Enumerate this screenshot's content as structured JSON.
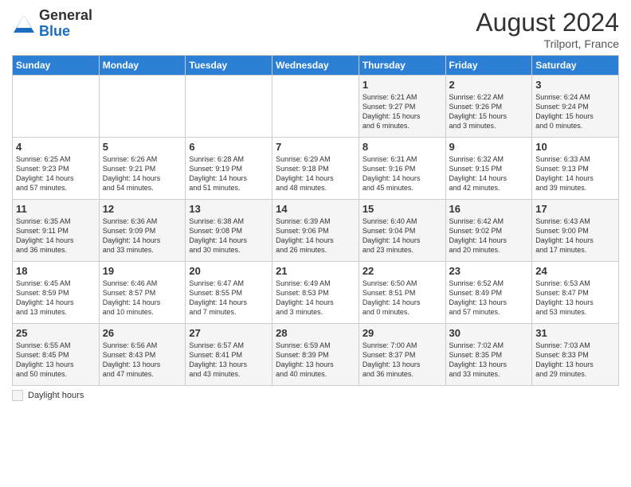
{
  "header": {
    "logo_general": "General",
    "logo_blue": "Blue",
    "month_year": "August 2024",
    "location": "Trilport, France"
  },
  "footer": {
    "legend_label": "Daylight hours"
  },
  "weekdays": [
    "Sunday",
    "Monday",
    "Tuesday",
    "Wednesday",
    "Thursday",
    "Friday",
    "Saturday"
  ],
  "weeks": [
    [
      {
        "day": "",
        "info": ""
      },
      {
        "day": "",
        "info": ""
      },
      {
        "day": "",
        "info": ""
      },
      {
        "day": "",
        "info": ""
      },
      {
        "day": "1",
        "info": "Sunrise: 6:21 AM\nSunset: 9:27 PM\nDaylight: 15 hours\nand 6 minutes."
      },
      {
        "day": "2",
        "info": "Sunrise: 6:22 AM\nSunset: 9:26 PM\nDaylight: 15 hours\nand 3 minutes."
      },
      {
        "day": "3",
        "info": "Sunrise: 6:24 AM\nSunset: 9:24 PM\nDaylight: 15 hours\nand 0 minutes."
      }
    ],
    [
      {
        "day": "4",
        "info": "Sunrise: 6:25 AM\nSunset: 9:23 PM\nDaylight: 14 hours\nand 57 minutes."
      },
      {
        "day": "5",
        "info": "Sunrise: 6:26 AM\nSunset: 9:21 PM\nDaylight: 14 hours\nand 54 minutes."
      },
      {
        "day": "6",
        "info": "Sunrise: 6:28 AM\nSunset: 9:19 PM\nDaylight: 14 hours\nand 51 minutes."
      },
      {
        "day": "7",
        "info": "Sunrise: 6:29 AM\nSunset: 9:18 PM\nDaylight: 14 hours\nand 48 minutes."
      },
      {
        "day": "8",
        "info": "Sunrise: 6:31 AM\nSunset: 9:16 PM\nDaylight: 14 hours\nand 45 minutes."
      },
      {
        "day": "9",
        "info": "Sunrise: 6:32 AM\nSunset: 9:15 PM\nDaylight: 14 hours\nand 42 minutes."
      },
      {
        "day": "10",
        "info": "Sunrise: 6:33 AM\nSunset: 9:13 PM\nDaylight: 14 hours\nand 39 minutes."
      }
    ],
    [
      {
        "day": "11",
        "info": "Sunrise: 6:35 AM\nSunset: 9:11 PM\nDaylight: 14 hours\nand 36 minutes."
      },
      {
        "day": "12",
        "info": "Sunrise: 6:36 AM\nSunset: 9:09 PM\nDaylight: 14 hours\nand 33 minutes."
      },
      {
        "day": "13",
        "info": "Sunrise: 6:38 AM\nSunset: 9:08 PM\nDaylight: 14 hours\nand 30 minutes."
      },
      {
        "day": "14",
        "info": "Sunrise: 6:39 AM\nSunset: 9:06 PM\nDaylight: 14 hours\nand 26 minutes."
      },
      {
        "day": "15",
        "info": "Sunrise: 6:40 AM\nSunset: 9:04 PM\nDaylight: 14 hours\nand 23 minutes."
      },
      {
        "day": "16",
        "info": "Sunrise: 6:42 AM\nSunset: 9:02 PM\nDaylight: 14 hours\nand 20 minutes."
      },
      {
        "day": "17",
        "info": "Sunrise: 6:43 AM\nSunset: 9:00 PM\nDaylight: 14 hours\nand 17 minutes."
      }
    ],
    [
      {
        "day": "18",
        "info": "Sunrise: 6:45 AM\nSunset: 8:59 PM\nDaylight: 14 hours\nand 13 minutes."
      },
      {
        "day": "19",
        "info": "Sunrise: 6:46 AM\nSunset: 8:57 PM\nDaylight: 14 hours\nand 10 minutes."
      },
      {
        "day": "20",
        "info": "Sunrise: 6:47 AM\nSunset: 8:55 PM\nDaylight: 14 hours\nand 7 minutes."
      },
      {
        "day": "21",
        "info": "Sunrise: 6:49 AM\nSunset: 8:53 PM\nDaylight: 14 hours\nand 3 minutes."
      },
      {
        "day": "22",
        "info": "Sunrise: 6:50 AM\nSunset: 8:51 PM\nDaylight: 14 hours\nand 0 minutes."
      },
      {
        "day": "23",
        "info": "Sunrise: 6:52 AM\nSunset: 8:49 PM\nDaylight: 13 hours\nand 57 minutes."
      },
      {
        "day": "24",
        "info": "Sunrise: 6:53 AM\nSunset: 8:47 PM\nDaylight: 13 hours\nand 53 minutes."
      }
    ],
    [
      {
        "day": "25",
        "info": "Sunrise: 6:55 AM\nSunset: 8:45 PM\nDaylight: 13 hours\nand 50 minutes."
      },
      {
        "day": "26",
        "info": "Sunrise: 6:56 AM\nSunset: 8:43 PM\nDaylight: 13 hours\nand 47 minutes."
      },
      {
        "day": "27",
        "info": "Sunrise: 6:57 AM\nSunset: 8:41 PM\nDaylight: 13 hours\nand 43 minutes."
      },
      {
        "day": "28",
        "info": "Sunrise: 6:59 AM\nSunset: 8:39 PM\nDaylight: 13 hours\nand 40 minutes."
      },
      {
        "day": "29",
        "info": "Sunrise: 7:00 AM\nSunset: 8:37 PM\nDaylight: 13 hours\nand 36 minutes."
      },
      {
        "day": "30",
        "info": "Sunrise: 7:02 AM\nSunset: 8:35 PM\nDaylight: 13 hours\nand 33 minutes."
      },
      {
        "day": "31",
        "info": "Sunrise: 7:03 AM\nSunset: 8:33 PM\nDaylight: 13 hours\nand 29 minutes."
      }
    ]
  ]
}
